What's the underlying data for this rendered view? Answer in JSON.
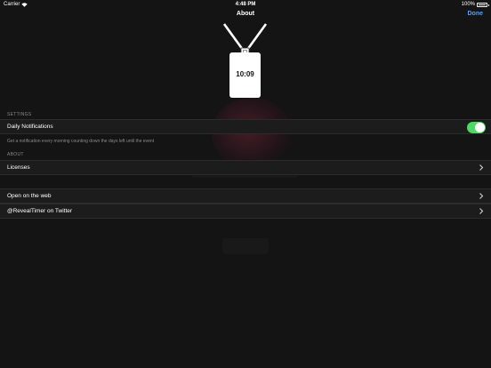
{
  "status_bar": {
    "carrier": "Carrier",
    "time": "4:48 PM",
    "battery": "100%"
  },
  "nav": {
    "title": "About",
    "done_label": "Done"
  },
  "badge": {
    "time": "10:09"
  },
  "settings": {
    "header": "SETTINGS",
    "daily_notifications_label": "Daily Notifications",
    "daily_notifications_on": true,
    "footer": "Get a notification every morning counting down the days left until the event"
  },
  "about": {
    "header": "ABOUT",
    "licenses_label": "Licenses",
    "web_label": "Open on the web",
    "twitter_label": "@RevealTimer on Twitter"
  },
  "colors": {
    "accent": "#4aa3ff",
    "toggle_on": "#4cd964",
    "background": "#141414"
  },
  "icons": {
    "wifi": "wifi-icon",
    "battery": "battery-icon",
    "chevron": "chevron-right-icon"
  }
}
